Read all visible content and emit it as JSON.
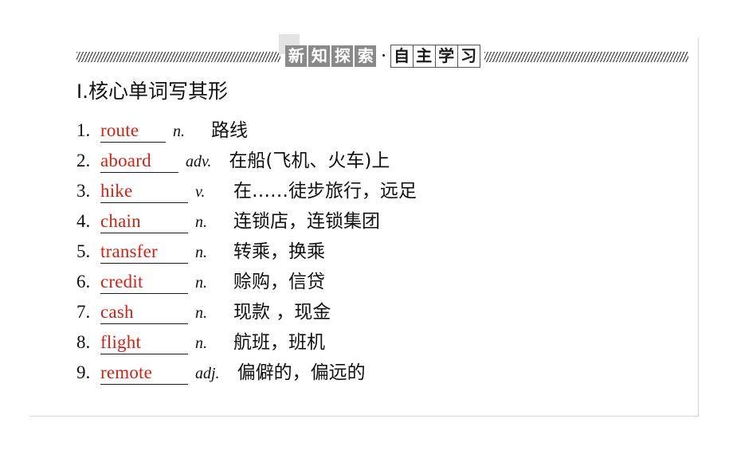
{
  "banner": {
    "solid_chars": [
      "新",
      "知",
      "探",
      "索"
    ],
    "separator": "·",
    "outline_chars": [
      "自",
      "主",
      "学",
      "习"
    ],
    "full_text": "新知探索·自主学习",
    "accent_solid_color": "#8a8a8a",
    "accent_text_color": "#ffffff",
    "ghost_color": "#e3e3e3"
  },
  "section": {
    "numeral": "Ⅰ",
    "dot": ".",
    "title": "核心单词写其形",
    "full_title": "Ⅰ.核心单词写其形"
  },
  "list": {
    "word_color": "#d81f12",
    "items": [
      {
        "num": "1.",
        "word": "route",
        "blank_width": "82",
        "pos": "n.",
        "meaning": "路线"
      },
      {
        "num": "2.",
        "word": "aboard",
        "blank_width": "98",
        "pos": "adv.",
        "meaning": "在船(飞机、火车)上"
      },
      {
        "num": "3.",
        "word": "hike",
        "blank_width": "110",
        "pos": "v.",
        "meaning": "在……徒步旅行，远足"
      },
      {
        "num": "4.",
        "word": "chain",
        "blank_width": "110",
        "pos": "n.",
        "meaning": "连锁店，连锁集团"
      },
      {
        "num": "5.",
        "word": "transfer",
        "blank_width": "110",
        "pos": "n.",
        "meaning": "转乘，换乘"
      },
      {
        "num": "6.",
        "word": "credit",
        "blank_width": "110",
        "pos": "n.",
        "meaning": "赊购，信贷"
      },
      {
        "num": "7.",
        "word": "cash",
        "blank_width": "110",
        "pos": "n.",
        "meaning": "现款 ，现金"
      },
      {
        "num": "8.",
        "word": "flight",
        "blank_width": "110",
        "pos": "n.",
        "meaning": "航班，班机"
      },
      {
        "num": "9.",
        "word": "remote",
        "blank_width": "110",
        "pos": "adj.",
        "meaning": "偏僻的，偏远的"
      }
    ]
  }
}
